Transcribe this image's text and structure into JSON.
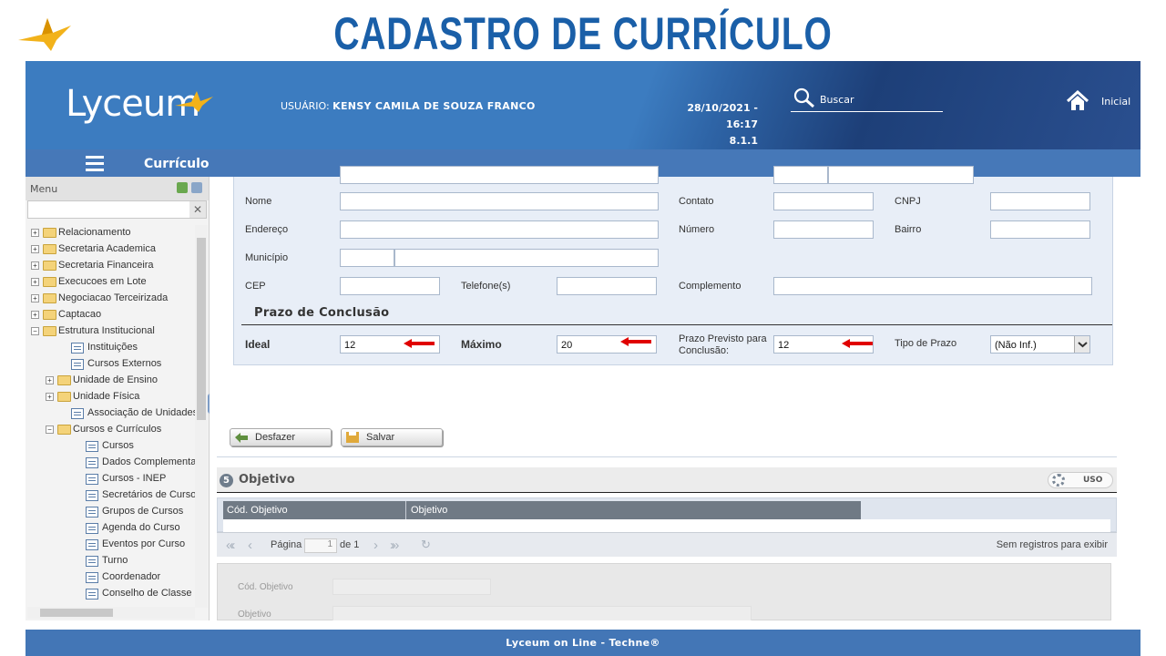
{
  "slide": {
    "title": "CADASTRO DE CURRÍCULO"
  },
  "header": {
    "logo_text": "Lyceum",
    "user_label": "USUÁRIO:",
    "user_name": "KENSY CAMILA DE SOUZA FRANCO",
    "datetime": "28/10/2021 - 16:17",
    "version": "8.1.1",
    "search_placeholder": "Buscar",
    "home_label": "Inicial"
  },
  "subbar": {
    "title": "Currículo"
  },
  "sidebar": {
    "menu_label": "Menu",
    "clear_label": "✕",
    "items": [
      {
        "label": "Relacionamento",
        "level": 0,
        "type": "folder",
        "expander": "+"
      },
      {
        "label": "Secretaria Academica",
        "level": 0,
        "type": "folder",
        "expander": "+"
      },
      {
        "label": "Secretaria Financeira",
        "level": 0,
        "type": "folder",
        "expander": "+"
      },
      {
        "label": "Execucoes em Lote",
        "level": 0,
        "type": "folder",
        "expander": "+"
      },
      {
        "label": "Negociacao Terceirizada",
        "level": 0,
        "type": "folder",
        "expander": "+"
      },
      {
        "label": "Captacao",
        "level": 0,
        "type": "folder",
        "expander": "+"
      },
      {
        "label": "Estrutura Institucional",
        "level": 0,
        "type": "folder",
        "expander": "−"
      },
      {
        "label": "Instituições",
        "level": 1,
        "type": "doc"
      },
      {
        "label": "Cursos Externos",
        "level": 1,
        "type": "doc"
      },
      {
        "label": "Unidade de Ensino",
        "level": 1,
        "type": "folder",
        "expander": "+"
      },
      {
        "label": "Unidade Física",
        "level": 1,
        "type": "folder",
        "expander": "+"
      },
      {
        "label": "Associação de Unidades",
        "level": 1,
        "type": "doc"
      },
      {
        "label": "Cursos e Currículos",
        "level": 1,
        "type": "folder",
        "expander": "−"
      },
      {
        "label": "Cursos",
        "level": 2,
        "type": "doc"
      },
      {
        "label": "Dados Complementares",
        "level": 2,
        "type": "doc"
      },
      {
        "label": "Cursos - INEP",
        "level": 2,
        "type": "doc"
      },
      {
        "label": "Secretários de Curso",
        "level": 2,
        "type": "doc"
      },
      {
        "label": "Grupos de Cursos",
        "level": 2,
        "type": "doc"
      },
      {
        "label": "Agenda do Curso",
        "level": 2,
        "type": "doc"
      },
      {
        "label": "Eventos por Curso",
        "level": 2,
        "type": "doc"
      },
      {
        "label": "Turno",
        "level": 2,
        "type": "doc"
      },
      {
        "label": "Coordenador",
        "level": 2,
        "type": "doc"
      },
      {
        "label": "Conselho de Classe",
        "level": 2,
        "type": "doc"
      }
    ]
  },
  "form": {
    "nome_label": "Nome",
    "contato_label": "Contato",
    "cnpj_label": "CNPJ",
    "endereco_label": "Endereço",
    "numero_label": "Número",
    "bairro_label": "Bairro",
    "municipio_label": "Município",
    "cep_label": "CEP",
    "telefone_label": "Telefone(s)",
    "complemento_label": "Complemento",
    "prazo_section": "Prazo de Conclusão",
    "ideal_label": "Ideal",
    "ideal_value": "12",
    "maximo_label": "Máximo",
    "maximo_value": "20",
    "previsto_label_1": "Prazo Previsto para",
    "previsto_label_2": "Conclusão:",
    "previsto_value": "12",
    "tipo_label": "Tipo de Prazo",
    "tipo_value": "(Não Inf.)"
  },
  "actions": {
    "desfazer": "Desfazer",
    "salvar": "Salvar"
  },
  "objetivo": {
    "number": "5",
    "title": "Objetivo",
    "uso_label": "USO",
    "columns": [
      "Cód. Objetivo",
      "Objetivo"
    ],
    "pager_page_label": "Página",
    "pager_page_value": "1",
    "pager_of_label": "de 1",
    "no_records": "Sem registros para exibir",
    "detail_cod_label": "Cód. Objetivo",
    "detail_obj_label": "Objetivo"
  },
  "footer": {
    "text": "Lyceum on Line - Techne®"
  },
  "colors": {
    "brand_blue": "#3c7cc0",
    "title_blue": "#1a5fa8",
    "arrow_red": "#e00000"
  }
}
